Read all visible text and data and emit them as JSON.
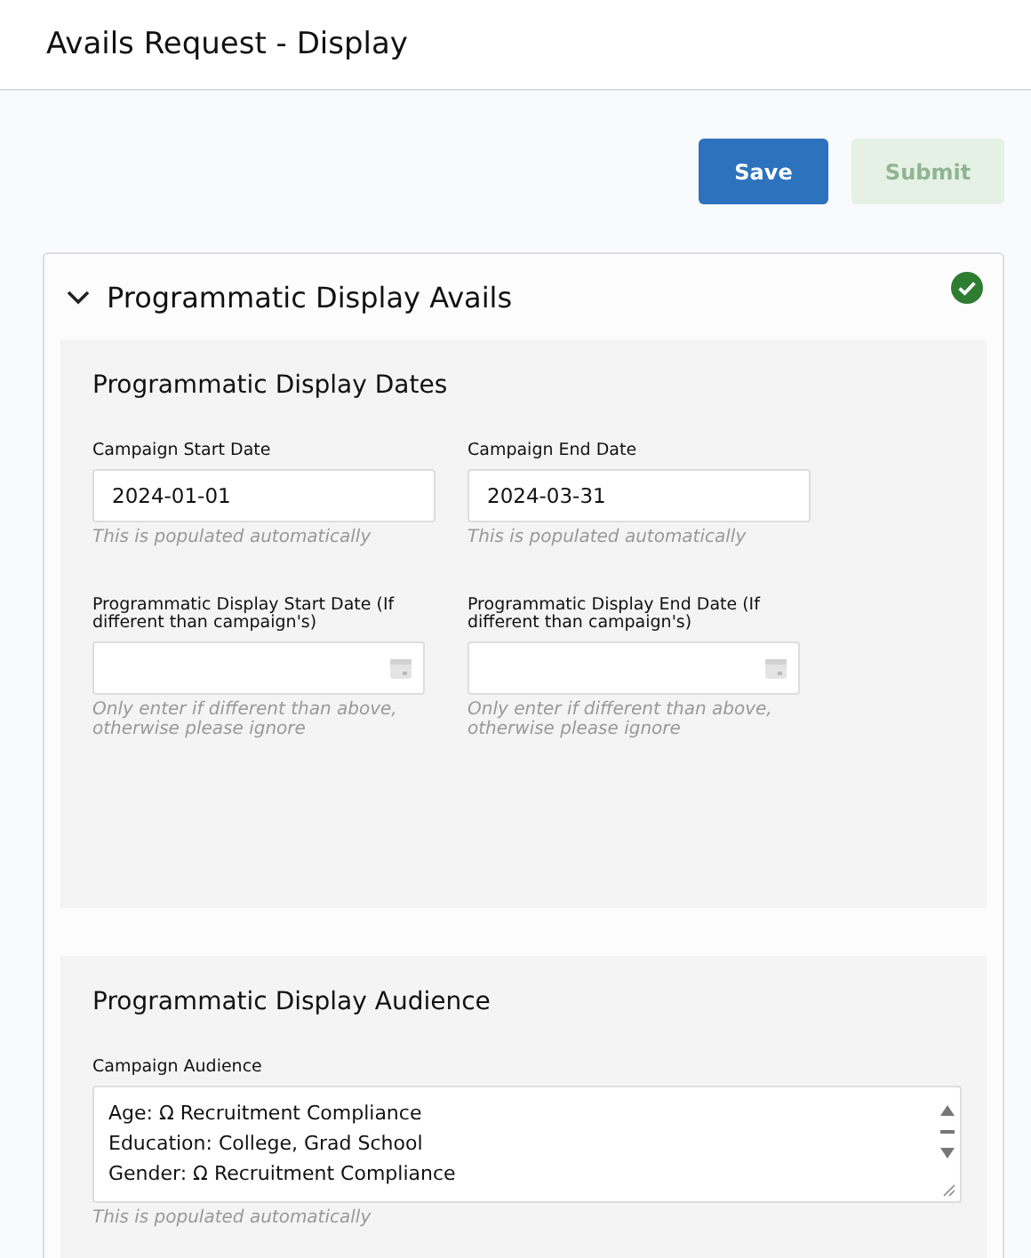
{
  "page": {
    "title": "Avails Request - Display"
  },
  "buttons": [
    {
      "label": "Save",
      "disabled": false,
      "kind": "primary"
    },
    {
      "label": "Submit",
      "disabled": true,
      "kind": "success"
    }
  ],
  "card": {
    "title": "Programmatic Display Avails",
    "expanded": true,
    "complete": true,
    "sections": [
      {
        "title": "Programmatic Display Dates",
        "fields": [
          {
            "kind": "text",
            "label": "Campaign Start Date",
            "value": "2024-01-01",
            "help": "This is populated automatically"
          },
          {
            "kind": "text",
            "label": "Campaign End Date",
            "value": "2024-03-31",
            "help": "This is populated automatically"
          },
          {
            "kind": "date",
            "label": "Programmatic Display Start Date (If different than campaign's)",
            "help": "Only enter if different than above, otherwise please ignore"
          },
          {
            "kind": "date",
            "label": "Programmatic Display End Date (If different than campaign's)",
            "help": "Only enter if different than above, otherwise please ignore"
          }
        ]
      },
      {
        "title": "Programmatic Display Audience",
        "fields": [
          {
            "kind": "textarea",
            "label": "Campaign Audience",
            "lines": [
              "Age: Ω Recruitment Compliance",
              "Education: College, Grad School",
              "Gender: Ω Recruitment Compliance"
            ],
            "help": "This is populated automatically"
          }
        ]
      }
    ]
  }
}
